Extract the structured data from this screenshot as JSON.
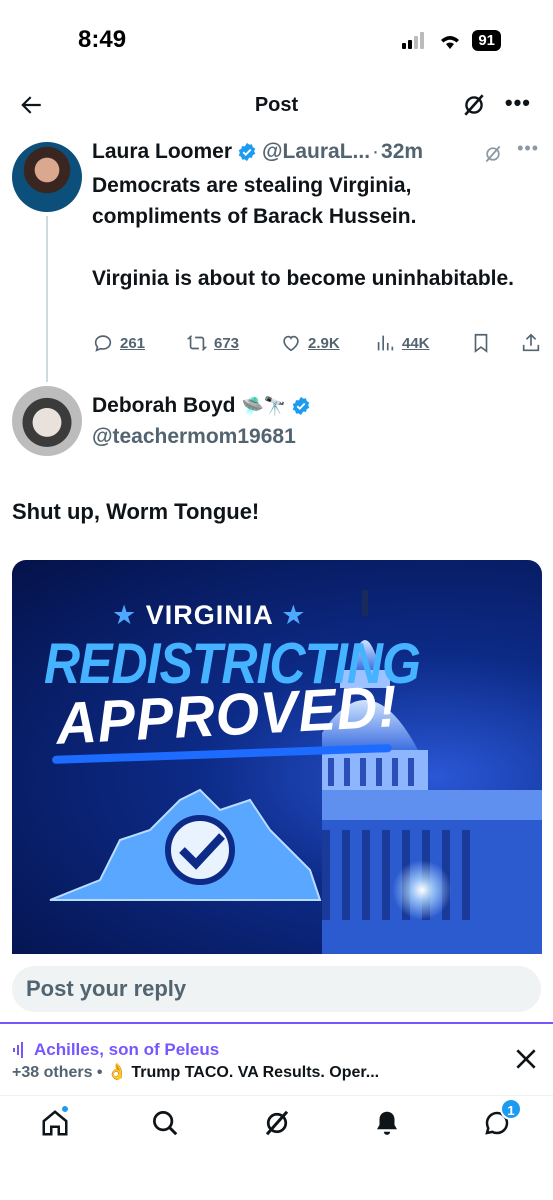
{
  "status_bar": {
    "time": "8:49",
    "battery": "91"
  },
  "header": {
    "title": "Post"
  },
  "tweet": {
    "author": "Laura Loomer",
    "handle": "@LauraL...",
    "separator": "·",
    "time": "32m",
    "text_line1": "Democrats are stealing Virginia, compliments of Barack Hussein.",
    "text_line2": "Virginia is about to become uninhabitable.",
    "stats": {
      "replies": "261",
      "reposts": "673",
      "likes": "2.9K",
      "views": "44K"
    }
  },
  "reply": {
    "author": "Deborah Boyd",
    "author_emoji": "🛸🔭",
    "handle": "@teachermom19681",
    "text": "Shut up, Worm Tongue!",
    "media": {
      "line1": "VIRGINIA",
      "star": "★",
      "line2": "REDISTRICTING",
      "line3": "APPROVED!"
    }
  },
  "reply_bar": {
    "placeholder": "Post your reply"
  },
  "space": {
    "host": "Achilles, son of Peleus",
    "listeners": "+38 others •",
    "emoji": "👌",
    "topic": "Trump TACO. VA Results. Oper..."
  },
  "tab_bar": {
    "dm_badge": "1"
  },
  "colors": {
    "accent": "#1d9bf0",
    "space_purple": "#7856ff",
    "secondary_text": "#536471"
  },
  "icons": [
    "back-arrow-icon",
    "grok-icon",
    "more-icon",
    "verified-icon",
    "reply-icon",
    "repost-icon",
    "like-icon",
    "views-icon",
    "bookmark-icon",
    "share-icon",
    "close-icon",
    "home-icon",
    "search-icon",
    "bell-icon",
    "messages-icon"
  ]
}
